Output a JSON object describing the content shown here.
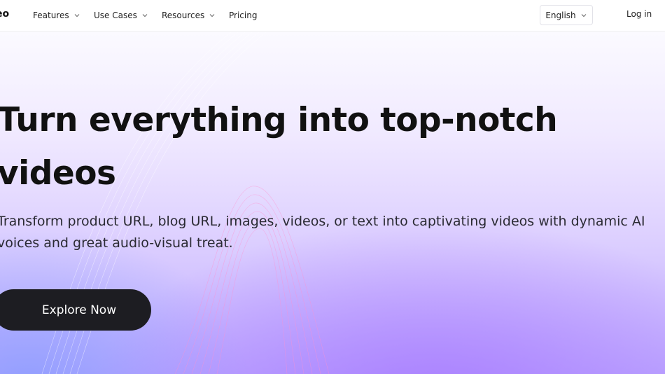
{
  "nav": {
    "logo_text": "eo",
    "items": [
      {
        "label": "Features"
      },
      {
        "label": "Use Cases"
      },
      {
        "label": "Resources"
      },
      {
        "label": "Pricing"
      }
    ],
    "language": "English",
    "login": "Log in"
  },
  "hero": {
    "headline_line1": "Turn everything into top-notch",
    "headline_line2": "videos",
    "subtext_line1": "Transform product URL, blog URL, images, videos, or text into captivating videos with dynamic AI",
    "subtext_line2": "voices and great audio-visual treat.",
    "cta_label": "Explore Now"
  },
  "colors": {
    "cta_bg": "#1d1d22",
    "gradient_top": "#fbfaff",
    "gradient_bottom": "#bea9ff"
  }
}
